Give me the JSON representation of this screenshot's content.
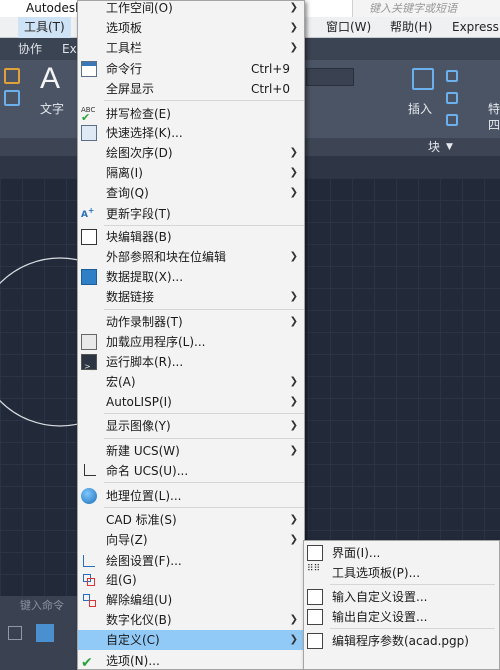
{
  "background": {
    "app_title": "Autodesk",
    "search_placeholder": "键入关键字或短语",
    "menubar": {
      "tools": "工具(T)",
      "window": "窗口(W)",
      "help": "帮助(H)",
      "express": "Express"
    },
    "tabs": {
      "collab": "协作",
      "exp": "Exp"
    },
    "ribbon": {
      "text_label": "文字",
      "insert_label": "插入",
      "block_label": "块",
      "special_label": "特",
      "four_label": "四"
    },
    "cmd_placeholder": "键入命令"
  },
  "menu": {
    "items": [
      {
        "label": "工作空间(O)",
        "shortcut": "",
        "submenu": true
      },
      {
        "label": "选项板",
        "shortcut": "",
        "submenu": true
      },
      {
        "label": "工具栏",
        "shortcut": "",
        "submenu": true
      },
      {
        "label": "命令行",
        "shortcut": "Ctrl+9",
        "submenu": false
      },
      {
        "label": "全屏显示",
        "shortcut": "Ctrl+0",
        "submenu": false
      },
      {
        "label": "拼写检查(E)",
        "shortcut": "",
        "submenu": false
      },
      {
        "label": "快速选择(K)...",
        "shortcut": "",
        "submenu": false
      },
      {
        "label": "绘图次序(D)",
        "shortcut": "",
        "submenu": true
      },
      {
        "label": "隔离(I)",
        "shortcut": "",
        "submenu": true
      },
      {
        "label": "查询(Q)",
        "shortcut": "",
        "submenu": true
      },
      {
        "label": "更新字段(T)",
        "shortcut": "",
        "submenu": false
      },
      {
        "label": "块编辑器(B)",
        "shortcut": "",
        "submenu": false
      },
      {
        "label": "外部参照和块在位编辑",
        "shortcut": "",
        "submenu": true
      },
      {
        "label": "数据提取(X)...",
        "shortcut": "",
        "submenu": false
      },
      {
        "label": "数据链接",
        "shortcut": "",
        "submenu": true
      },
      {
        "label": "动作录制器(T)",
        "shortcut": "",
        "submenu": true
      },
      {
        "label": "加载应用程序(L)...",
        "shortcut": "",
        "submenu": false
      },
      {
        "label": "运行脚本(R)...",
        "shortcut": "",
        "submenu": false
      },
      {
        "label": "宏(A)",
        "shortcut": "",
        "submenu": true
      },
      {
        "label": "AutoLISP(I)",
        "shortcut": "",
        "submenu": true
      },
      {
        "label": "显示图像(Y)",
        "shortcut": "",
        "submenu": true
      },
      {
        "label": "新建 UCS(W)",
        "shortcut": "",
        "submenu": true
      },
      {
        "label": "命名 UCS(U)...",
        "shortcut": "",
        "submenu": false
      },
      {
        "label": "地理位置(L)...",
        "shortcut": "",
        "submenu": false
      },
      {
        "label": "CAD 标准(S)",
        "shortcut": "",
        "submenu": true
      },
      {
        "label": "向导(Z)",
        "shortcut": "",
        "submenu": true
      },
      {
        "label": "绘图设置(F)...",
        "shortcut": "",
        "submenu": false
      },
      {
        "label": "组(G)",
        "shortcut": "",
        "submenu": false
      },
      {
        "label": "解除编组(U)",
        "shortcut": "",
        "submenu": false
      },
      {
        "label": "数字化仪(B)",
        "shortcut": "",
        "submenu": true
      },
      {
        "label": "自定义(C)",
        "shortcut": "",
        "submenu": true
      },
      {
        "label": "选项(N)...",
        "shortcut": "",
        "submenu": false
      }
    ]
  },
  "submenu": {
    "items": [
      {
        "label": "界面(I)..."
      },
      {
        "label": "工具选项板(P)..."
      },
      {
        "label": "输入自定义设置..."
      },
      {
        "label": "输出自定义设置..."
      },
      {
        "label": "编辑程序参数(acad.pgp)"
      }
    ]
  },
  "colors": {
    "highlight": "#91c9f7",
    "menu_bg": "#f3f3f3",
    "drawing_bg": "#222a39"
  }
}
